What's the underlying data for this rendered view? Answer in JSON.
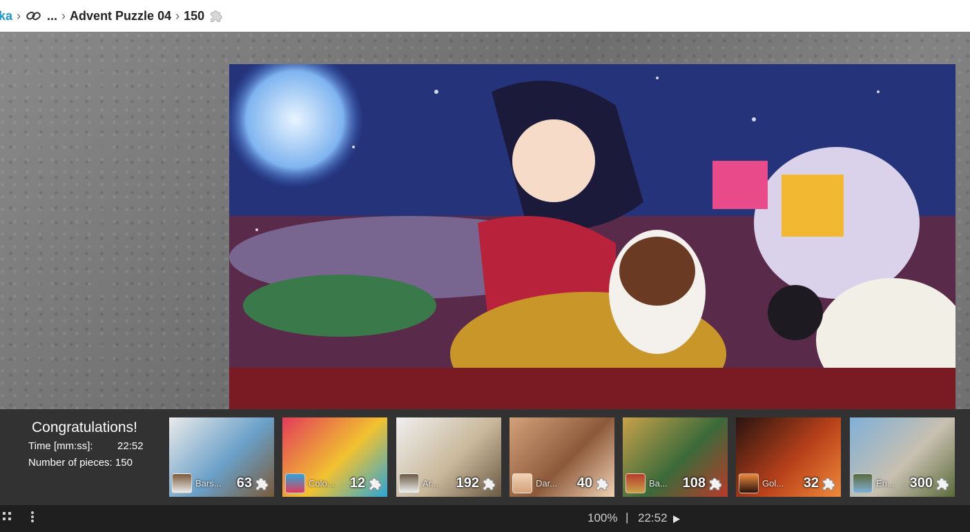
{
  "breadcrumb": {
    "user": "ka",
    "ellipsis": "...",
    "puzzle_name": "Advent Puzzle 04",
    "pieces": "150"
  },
  "congrats": {
    "title": "Congratulations!",
    "time_label": "Time [mm:ss]:",
    "time_value": "22:52",
    "pieces_label": "Number of pieces: 150"
  },
  "thumbnails": [
    {
      "name": "Bars...",
      "count": "63",
      "colors": [
        "#eaeaea",
        "#6aa0c8",
        "#7a5a3a"
      ]
    },
    {
      "name": "Colo...",
      "count": "12",
      "colors": [
        "#e23b5a",
        "#f2c230",
        "#2aa7d8"
      ]
    },
    {
      "name": "Ar...",
      "count": "192",
      "colors": [
        "#efefef",
        "#c9b89a",
        "#6b5a44"
      ]
    },
    {
      "name": "Dar...",
      "count": "40",
      "colors": [
        "#d3a27a",
        "#8c5a3a",
        "#f0d2b4"
      ]
    },
    {
      "name": "Ba...",
      "count": "108",
      "colors": [
        "#c8a24a",
        "#3b6a3a",
        "#b83a2a"
      ]
    },
    {
      "name": "Gol...",
      "count": "32",
      "colors": [
        "#2a1410",
        "#b8401a",
        "#f08a3a"
      ]
    },
    {
      "name": "En...",
      "count": "300",
      "colors": [
        "#7fb0d8",
        "#c8c0b0",
        "#5a6a3a"
      ]
    }
  ],
  "status": {
    "zoom": "100%",
    "divider": "|",
    "clock": "22:52"
  },
  "icons": {
    "breadcrumb_link": "link-icon",
    "breadcrumb_puzzle": "puzzle-piece-icon",
    "grid": "grid-icon",
    "menu": "vertical-dots-icon",
    "play": "play-icon"
  }
}
